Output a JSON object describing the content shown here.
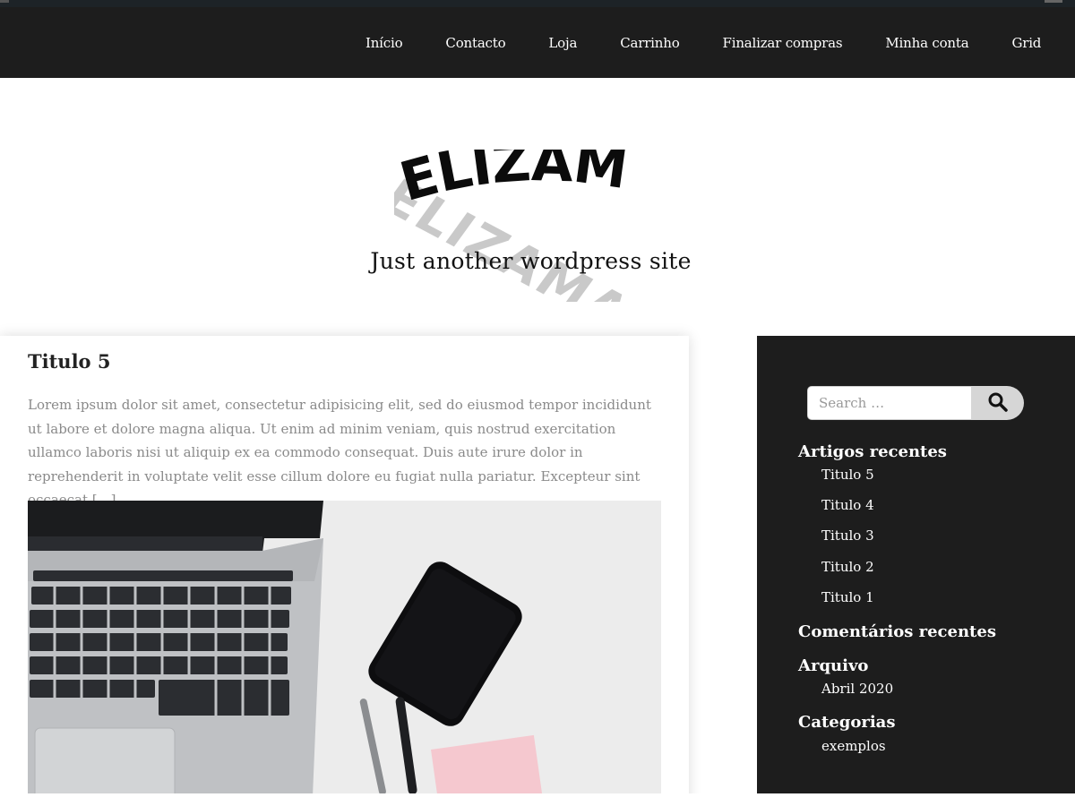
{
  "nav": {
    "items": [
      "Início",
      "Contacto",
      "Loja",
      "Carrinho",
      "Finalizar compras",
      "Minha conta",
      "Grid"
    ]
  },
  "site": {
    "logo_text": "ELIZAMA",
    "tagline": "Just another wordpress site"
  },
  "post": {
    "title": "Titulo 5",
    "excerpt": "Lorem ipsum dolor sit amet, consectetur adipisicing elit, sed do eiusmod tempor incididunt ut labore et dolore magna aliqua. Ut enim ad minim veniam, quis nostrud exercitation ullamco laboris nisi ut aliquip ex ea commodo consequat. Duis aute irure dolor in reprehenderit in voluptate velit esse cillum dolore eu fugiat nulla pariatur. Excepteur sint occaecat […]"
  },
  "sidebar": {
    "search": {
      "placeholder": "Search …"
    },
    "recent_posts": {
      "title": "Artigos recentes",
      "items": [
        "Titulo 5",
        "Titulo 4",
        "Titulo 3",
        "Titulo 2",
        "Titulo 1"
      ]
    },
    "recent_comments": {
      "title": "Comentários recentes"
    },
    "archive": {
      "title": "Arquivo",
      "items": [
        "Abril 2020"
      ]
    },
    "categories": {
      "title": "Categorias",
      "items": [
        "exemplos"
      ]
    }
  },
  "icons": {
    "search": "search-icon",
    "logo": "elizama-logo"
  },
  "colors": {
    "nav_bg": "#1d1d1d",
    "sidebar_bg": "#1d1d1d",
    "excerpt_text": "#8a8a8a",
    "search_button": "#d6d6d6"
  }
}
